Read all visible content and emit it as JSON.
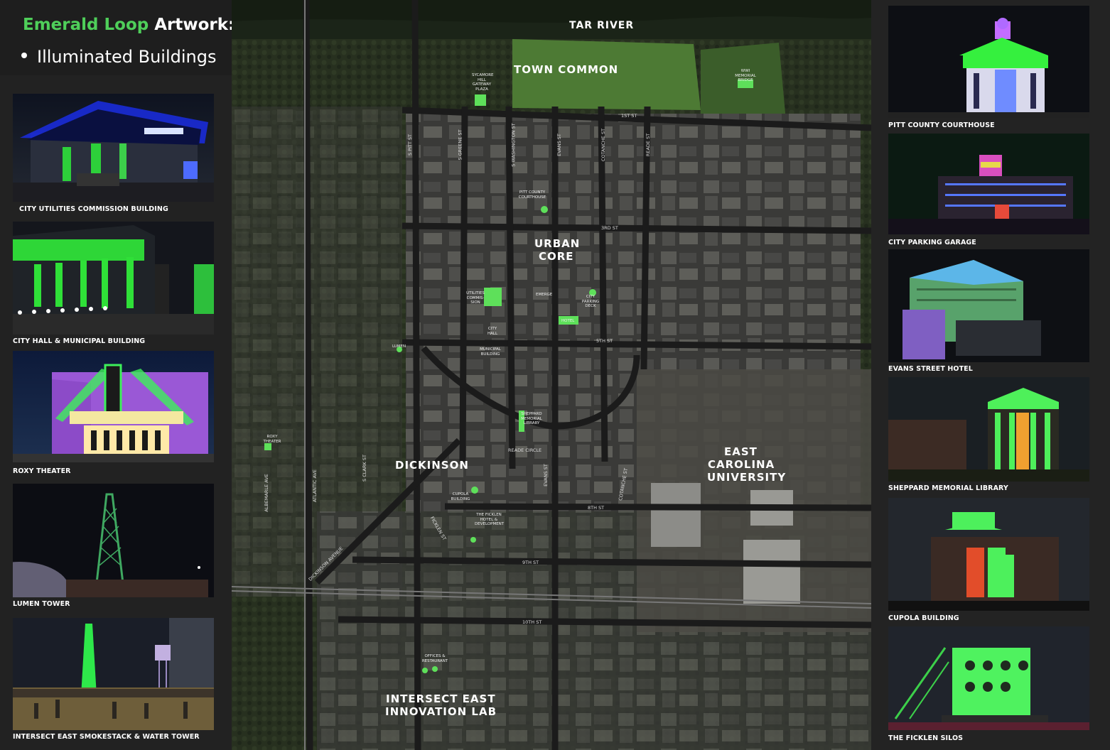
{
  "title": {
    "accent": "Emerald Loop",
    "rest": " Artwork:"
  },
  "bullet": "Illuminated Buildings",
  "left_captions": [
    "CITY UTILITIES COMMISSION BUILDING",
    "CITY HALL & MUNICIPAL BUILDING",
    "ROXY THEATER",
    "LUMEN TOWER",
    "INTERSECT EAST SMOKESTACK & WATER TOWER"
  ],
  "right_captions": [
    "PITT COUNTY COURTHOUSE",
    "CITY PARKING GARAGE",
    "EVANS STREET HOTEL",
    "SHEPPARD MEMORIAL LIBRARY",
    "CUPOLA BUILDING",
    "THE FICKLEN SILOS"
  ],
  "map": {
    "areas": {
      "tar_river": "TAR RIVER",
      "town_common": "TOWN COMMON",
      "urban_core_1": "URBAN",
      "urban_core_2": "CORE",
      "dickinson": "DICKINSON",
      "ecu_1": "EAST",
      "ecu_2": "CAROLINA",
      "ecu_3": "UNIVERSITY",
      "intersect_1": "INTERSECT EAST",
      "intersect_2": "INNOVATION LAB"
    },
    "streets": {
      "first": "1ST ST",
      "third": "3RD ST",
      "fifth": "5TH ST",
      "eighth": "8TH ST",
      "ninth": "9TH ST",
      "tenth": "10TH ST",
      "pitt": "S PITT ST",
      "greene": "S GREENE ST",
      "washington": "S WASHINGTON ST",
      "evans_n": "EVANS ST",
      "cotanche_n": "COTANCHE ST",
      "reade_st": "READE ST",
      "reade_circle": "READE CIRCLE",
      "evans_s": "EVANS ST",
      "cotanche_s": "COTANCHE ST",
      "clark": "S CLARK ST",
      "albemarle": "ALBEMARLE AVE",
      "atlantic": "ATLANTIC AVE",
      "dickinson_ave": "DICKINSON AVENUE",
      "ficklen": "FICKLEN ST"
    },
    "sites": {
      "sycamore": "SYCAMORE HILL GATEWAY PLAZA",
      "wwi": "WWI MEMORIAL BRIDGE",
      "courthouse": "PITT COUNTY COURTHOUSE",
      "utilities": "UTILITIES COMMIS-SION",
      "emerge": "EMERGE",
      "parking": "CITY PARKING DECK",
      "hotel": "HOTEL",
      "city_hall": "CITY HALL",
      "municipal": "MUNICIPAL BUILDING",
      "lumen": "LUMEN",
      "sheppard": "SHEPPARD MEMORIAL LIBRARY",
      "roxy": "ROXY THEATER",
      "cupola": "CUPOLA BUILDING",
      "ficklen": "THE FICKLEN HOTEL & DEVELOPMENT",
      "offices": "OFFICES & RESTAURANT"
    }
  }
}
